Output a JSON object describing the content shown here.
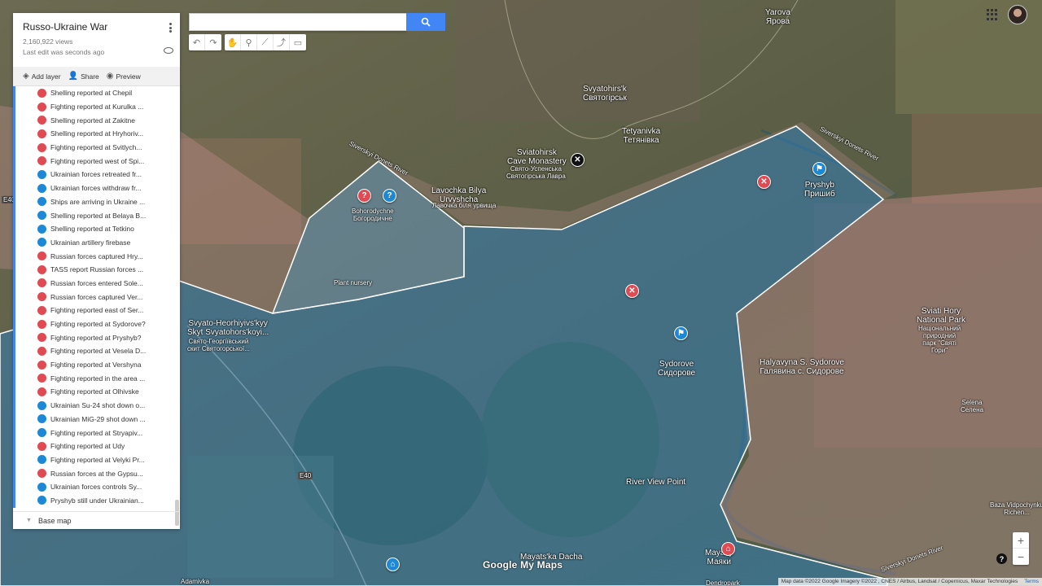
{
  "search": {
    "placeholder": ""
  },
  "panel": {
    "title": "Russo-Ukraine War",
    "views": "2,160,922 views",
    "last_edit": "Last edit was seconds ago",
    "actions": {
      "add_layer": "Add layer",
      "share": "Share",
      "preview": "Preview"
    },
    "items": [
      {
        "label": "Shelling reported at Chepil",
        "color": "red"
      },
      {
        "label": "Fighting reported at Kurulka ...",
        "color": "red"
      },
      {
        "label": "Shelling reported at Zakitne",
        "color": "red"
      },
      {
        "label": "Shelling reported at Hryhoriv...",
        "color": "red"
      },
      {
        "label": "Fighting reported at Svitlych...",
        "color": "red"
      },
      {
        "label": "Fighting reported west of Spi...",
        "color": "red"
      },
      {
        "label": "Ukrainian forces retreated fr...",
        "color": "blue"
      },
      {
        "label": "Ukrainian forces withdraw fr...",
        "color": "blue"
      },
      {
        "label": "Ships are arriving in Ukraine ...",
        "color": "blue"
      },
      {
        "label": "Shelling reported at Belaya B...",
        "color": "blue"
      },
      {
        "label": "Shelling reported at Tetkino",
        "color": "blue"
      },
      {
        "label": "Ukrainian artillery firebase",
        "color": "blue"
      },
      {
        "label": "Russian forces captured Hry...",
        "color": "red"
      },
      {
        "label": "TASS report Russian forces ...",
        "color": "red"
      },
      {
        "label": "Russian forces entered Sole...",
        "color": "red"
      },
      {
        "label": "Russian forces captured Ver...",
        "color": "red"
      },
      {
        "label": "Fighting reported east of Ser...",
        "color": "red"
      },
      {
        "label": "Fighting reported at Sydorove?",
        "color": "red"
      },
      {
        "label": "Fighting reported at Pryshyb?",
        "color": "red"
      },
      {
        "label": "Fighting reported at Vesela D...",
        "color": "red"
      },
      {
        "label": "Fighting reported at Vershyna",
        "color": "red"
      },
      {
        "label": "Fighting reported in the area ...",
        "color": "red"
      },
      {
        "label": "Fighting reported at Olhivske",
        "color": "red"
      },
      {
        "label": "Ukrainian Su-24 shot down o...",
        "color": "blue"
      },
      {
        "label": "Ukrainian MiG-29 shot down ...",
        "color": "blue"
      },
      {
        "label": "Fighting reported at Stryapiv...",
        "color": "blue"
      },
      {
        "label": "Fighting reported at Udy",
        "color": "red"
      },
      {
        "label": "Fighting reported at Velyki Pr...",
        "color": "blue"
      },
      {
        "label": "Russian forces at the Gypsu...",
        "color": "red"
      },
      {
        "label": "Ukrainian forces controls Sy...",
        "color": "blue"
      },
      {
        "label": "Pryshyb still under Ukrainian...",
        "color": "blue"
      }
    ],
    "base_map": "Base map"
  },
  "map": {
    "labels": {
      "yarova": "Yarova\nЯрова",
      "svyatohirsk": "Svyatohirs'k\nСвятогірськ",
      "tetyanivka": "Tetyanivka\nТетянівка",
      "monastery": "Sviatohirsk\nCave Monastery",
      "monastery_sub": "Свято-Успенська\nСвятогірська Лавра",
      "lavochka": "Lavochka Bilya\nUrvyshcha",
      "lavochka_sub": "Лавочка біля урвища",
      "bohorodychne": "Bohorodychne\nБогородичне",
      "plant_nursery": "Plant nursery",
      "pryshyb": "Pryshyb\nПришиб",
      "skyt": "Svyato-Heorhiyivs'kyy\nSkyt Svyatohors'koyi...",
      "skyt_sub": "Свято-Георгіївський\nскит Святогорської...",
      "sydorove": "Sydorove\nСидорове",
      "halyavyna": "Halyavyna S. Sydorove\nГалявина с. Сидорове",
      "sviati_hory": "Sviati Hory\nNational Park",
      "sviati_hory_sub": "Національний\nприродний\nпарк \"Святі\nГори\"",
      "selena": "Selena\nСелена",
      "river_view": "River View Point",
      "mayatska": "Mayats'ka Dacha",
      "mayaky": "Mayaky\nМаяки",
      "dendropark": "Dendropark",
      "adamivka": "Adamivka",
      "baza": "Baza Vidpochynku\nRichen...",
      "e40": "E40",
      "e40b": "E40",
      "donets1": "Siverskyi Donets River",
      "donets2": "Siverskyi Donets River",
      "donets3": "Siverskyi Donets River"
    },
    "logo": "Google My Maps",
    "attribution": "Map data ©2022 Google Imagery ©2022 , CNES / Airbus, Landsat / Copernicus, Maxar Technologies",
    "terms": "Terms"
  },
  "colors": {
    "ukraine_fill": "#2f7fc0",
    "russia_fill": "#e8a0a8",
    "border": "#ffffff",
    "marker_red": "#e04a52",
    "marker_blue": "#1c88d6"
  }
}
